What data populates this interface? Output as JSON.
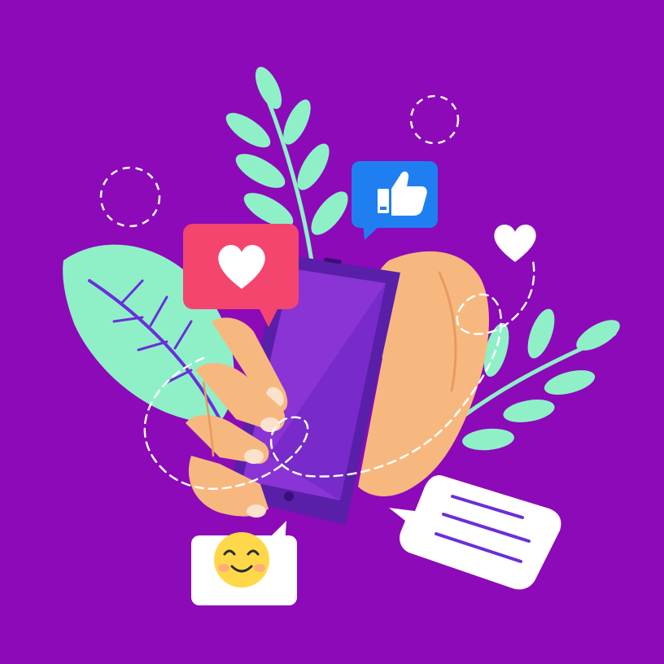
{
  "colors": {
    "background": "#8c0ab8",
    "leaf": "#8ff0c8",
    "leaf_vein": "#6a2fd8",
    "hand": "#f7b880",
    "hand_shade": "#e8995f",
    "nail": "#fbe2cc",
    "phone_body": "#5a1fa8",
    "phone_screen": "#8a34d6",
    "heart_bubble": "#f4456e",
    "like_bubble": "#1f7ff0",
    "bubble_white": "#ffffff",
    "emoji_face": "#ffd84a",
    "emoji_cheek": "#ff9a8a",
    "dashed_line": "#ffffff"
  },
  "icons": [
    "heart-icon",
    "thumbs-up-icon",
    "smile-emoji-icon",
    "chat-lines-icon",
    "small-heart-icon"
  ]
}
